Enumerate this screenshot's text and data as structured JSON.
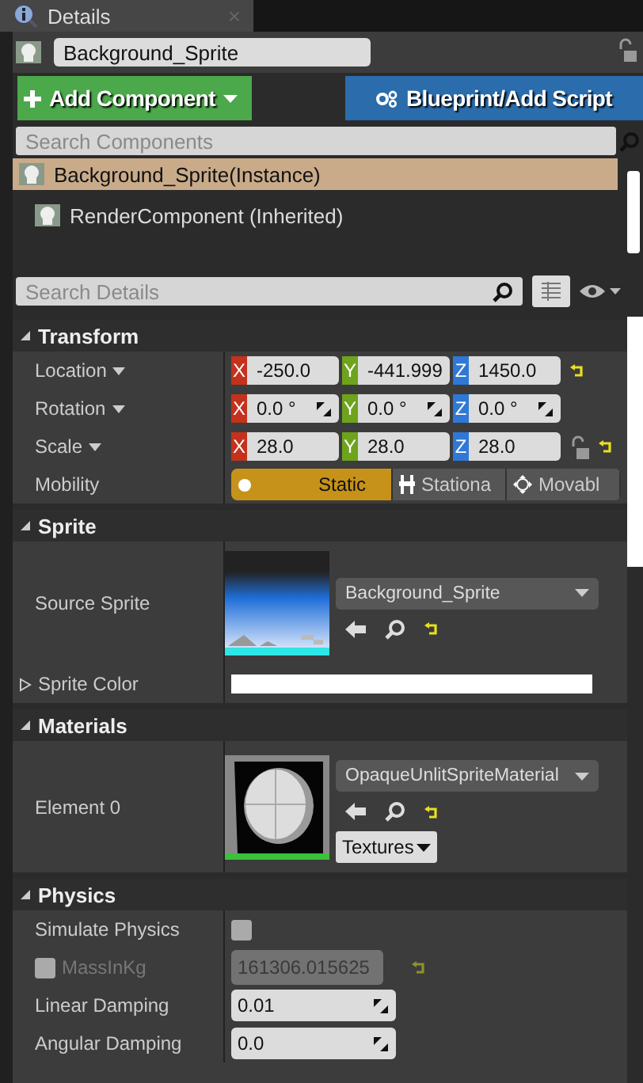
{
  "tab": {
    "title": "Details",
    "close": "×"
  },
  "actor": {
    "name": "Background_Sprite"
  },
  "buttons": [
    {
      "label": "Add Component",
      "kind": "add"
    },
    {
      "label": "Blueprint/Add Script",
      "kind": "blueprint"
    }
  ],
  "component_search": {
    "placeholder": "Search Components"
  },
  "components": [
    {
      "label": "Background_Sprite(Instance)",
      "selected": true,
      "children": [
        {
          "label": "RenderComponent (Inherited)",
          "selected": false
        }
      ]
    }
  ],
  "details_search": {
    "placeholder": "Search Details"
  },
  "sections": [
    {
      "title": "Transform",
      "expanded": true,
      "rows": [
        {
          "kind": "vector",
          "label": "Location",
          "dropdown": true,
          "spinner": false,
          "lock": false,
          "reset": true,
          "fields": [
            {
              "axis": "X",
              "color": "#c4311c",
              "value": "-250.0"
            },
            {
              "axis": "Y",
              "color": "#6ea31c",
              "value": "-441.999"
            },
            {
              "axis": "Z",
              "color": "#2f78d6",
              "value": "1450.0"
            }
          ]
        },
        {
          "kind": "vector",
          "label": "Rotation",
          "dropdown": true,
          "spinner": true,
          "lock": false,
          "reset": false,
          "fields": [
            {
              "axis": "X",
              "color": "#c4311c",
              "value": "0.0 °"
            },
            {
              "axis": "Y",
              "color": "#6ea31c",
              "value": "0.0 °"
            },
            {
              "axis": "Z",
              "color": "#2f78d6",
              "value": "0.0 °"
            }
          ]
        },
        {
          "kind": "vector",
          "label": "Scale",
          "dropdown": true,
          "spinner": false,
          "lock": true,
          "reset": true,
          "fields": [
            {
              "axis": "X",
              "color": "#c4311c",
              "value": "28.0"
            },
            {
              "axis": "Y",
              "color": "#6ea31c",
              "value": "28.0"
            },
            {
              "axis": "Z",
              "color": "#2f78d6",
              "value": "28.0"
            }
          ]
        },
        {
          "kind": "toggle",
          "label": "Mobility",
          "options": [
            {
              "label": "Static",
              "selected": true
            },
            {
              "label": "Stationa",
              "selected": false
            },
            {
              "label": "Movabl",
              "selected": false
            }
          ]
        }
      ]
    },
    {
      "title": "Sprite",
      "expanded": true,
      "rows": [
        {
          "kind": "asset",
          "label": "Source Sprite",
          "value": "Background_Sprite",
          "reset": true
        },
        {
          "kind": "color",
          "label": "Sprite Color",
          "expanded": false,
          "color": "#ffffff"
        }
      ]
    },
    {
      "title": "Materials",
      "expanded": true,
      "rows": [
        {
          "kind": "asset",
          "label": "Element 0",
          "value": "OpaqueUnlitSpriteMaterial",
          "reset": true,
          "extra": "Textures"
        }
      ]
    },
    {
      "title": "Physics",
      "expanded": true,
      "rows": [
        {
          "kind": "checkbox",
          "label": "Simulate Physics",
          "checked": false
        },
        {
          "kind": "number",
          "label": "MassInKg",
          "override": false,
          "disabled": true,
          "value": "161306.015625",
          "spinner": false,
          "reset": true
        },
        {
          "kind": "number",
          "label": "Linear Damping",
          "disabled": false,
          "value": "0.01",
          "spinner": true,
          "reset": false
        },
        {
          "kind": "number",
          "label": "Angular Damping",
          "disabled": false,
          "value": "0.0",
          "spinner": true,
          "reset": false
        }
      ]
    }
  ]
}
